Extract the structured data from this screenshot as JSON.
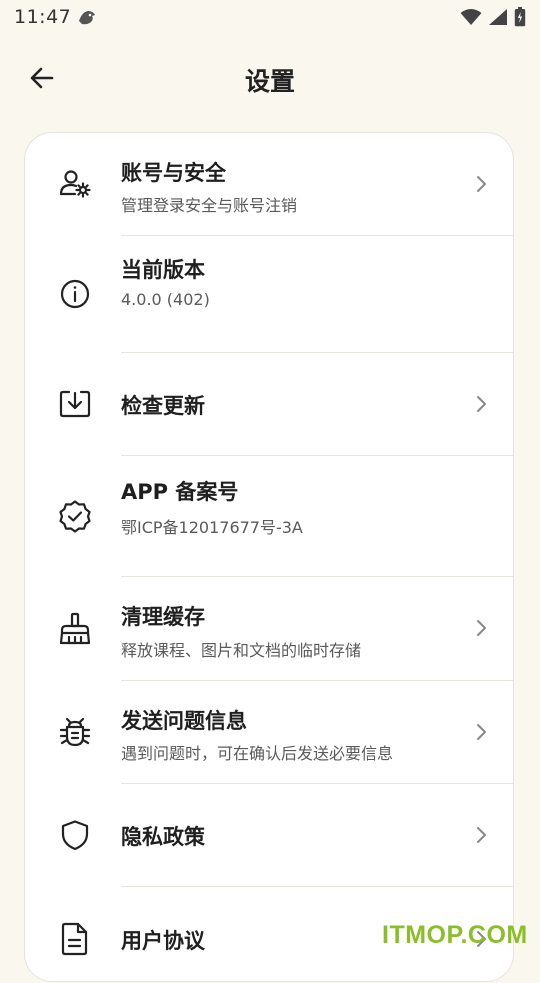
{
  "status_bar": {
    "time": "11:47"
  },
  "header": {
    "title": "设置"
  },
  "settings": {
    "account": {
      "title": "账号与安全",
      "subtitle": "管理登录安全与账号注销"
    },
    "version": {
      "title": "当前版本",
      "subtitle": "4.0.0 (402)"
    },
    "update": {
      "title": "检查更新"
    },
    "icp": {
      "title": "APP 备案号",
      "subtitle": "鄂ICP备12017677号-3A"
    },
    "cache": {
      "title": "清理缓存",
      "subtitle": "释放课程、图片和文档的临时存储"
    },
    "feedback": {
      "title": "发送问题信息",
      "subtitle": "遇到问题时，可在确认后发送必要信息"
    },
    "privacy": {
      "title": "隐私政策"
    },
    "agreement": {
      "title": "用户协议"
    }
  },
  "watermark": {
    "text": "ITMOP.COM",
    "color": "#8bbf2a"
  },
  "icons": {
    "account": "user-gear-icon",
    "version": "info-icon",
    "update": "download-icon",
    "icp": "verified-badge-icon",
    "cache": "broom-icon",
    "feedback": "bug-icon",
    "privacy": "shield-icon",
    "agreement": "document-icon"
  },
  "colors": {
    "background": "#faf7ef",
    "card": "#ffffff",
    "divider": "#e7e4de"
  }
}
